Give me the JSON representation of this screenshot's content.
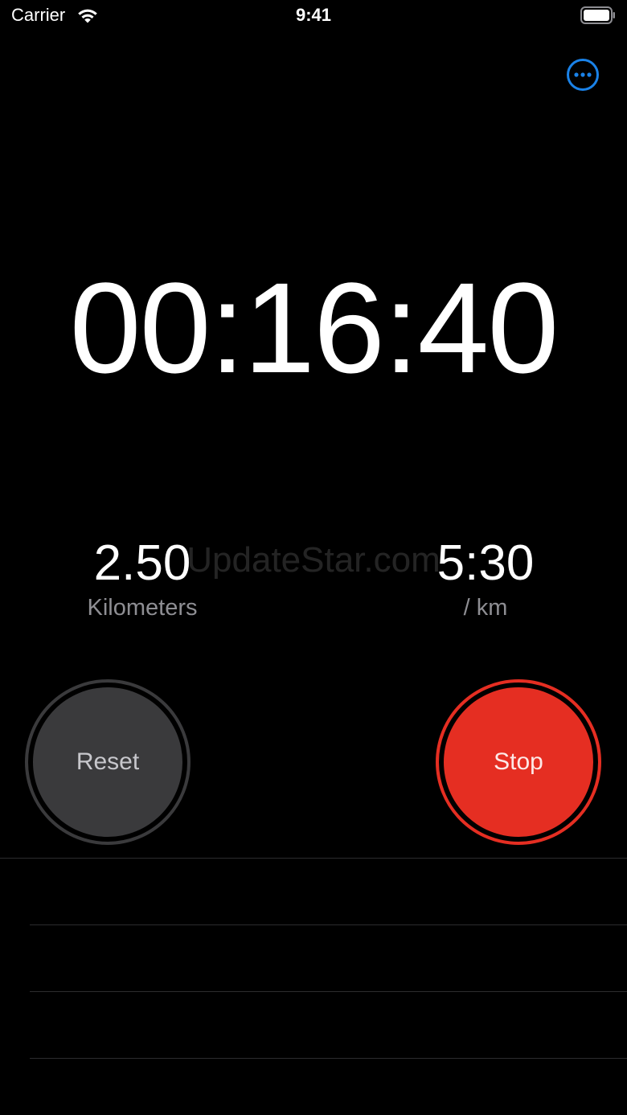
{
  "status_bar": {
    "carrier": "Carrier",
    "time": "9:41",
    "icons": [
      "wifi-icon",
      "battery-icon"
    ]
  },
  "toolbar": {
    "more_icon": "ellipsis-circle-icon",
    "accent_color": "#1a82e8"
  },
  "timer": {
    "elapsed": "00:16:40"
  },
  "stats": {
    "distance": {
      "value": "2.50",
      "label": "Kilometers"
    },
    "pace": {
      "value": "5:30",
      "label": "/ km"
    }
  },
  "watermark": "UpdateStar.com",
  "controls": {
    "reset_label": "Reset",
    "stop_label": "Stop",
    "reset_color": "#3a3a3c",
    "stop_color": "#e52e22"
  },
  "laps": []
}
